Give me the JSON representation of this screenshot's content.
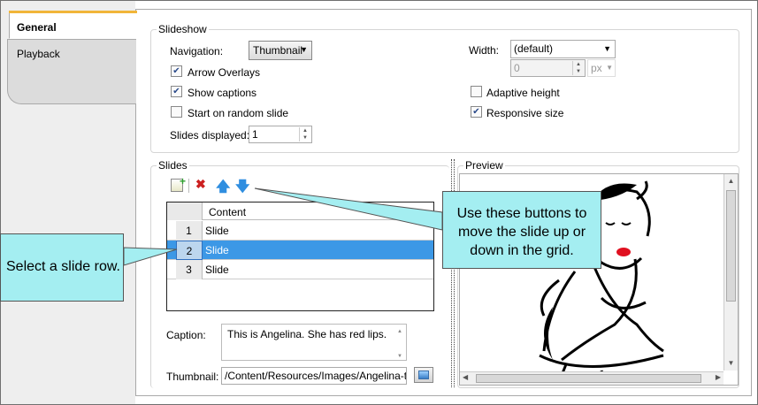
{
  "tabs": [
    {
      "label": "General"
    },
    {
      "label": "Playback"
    }
  ],
  "slideshow": {
    "legend": "Slideshow",
    "navigation_label": "Navigation:",
    "navigation_value": "Thumbnail",
    "arrow_overlays": "Arrow Overlays",
    "show_captions": "Show captions",
    "start_random": "Start on random slide",
    "slides_displayed_label": "Slides displayed:",
    "slides_displayed_value": "1",
    "width_label": "Width:",
    "width_value": "(default)",
    "width_number": "0",
    "width_unit": "px",
    "adaptive_height": "Adaptive height",
    "responsive_size": "Responsive size"
  },
  "slides": {
    "legend": "Slides",
    "column_header": "Content",
    "rows": [
      {
        "num": "1",
        "content": "Slide"
      },
      {
        "num": "2",
        "content": "Slide"
      },
      {
        "num": "3",
        "content": "Slide"
      }
    ],
    "caption_label": "Caption:",
    "caption_value": "This is Angelina. She has red lips.",
    "thumbnail_label": "Thumbnail:",
    "thumbnail_value": "/Content/Resources/Images/Angelina-thum"
  },
  "preview": {
    "legend": "Preview"
  },
  "callouts": {
    "buttons": "Use these buttons to move the slide up or down in the grid.",
    "select": "Select a slide row."
  },
  "colors": {
    "selection": "#3c98e6",
    "callout": "#a4eef1",
    "tab_accent": "#f1b539"
  }
}
